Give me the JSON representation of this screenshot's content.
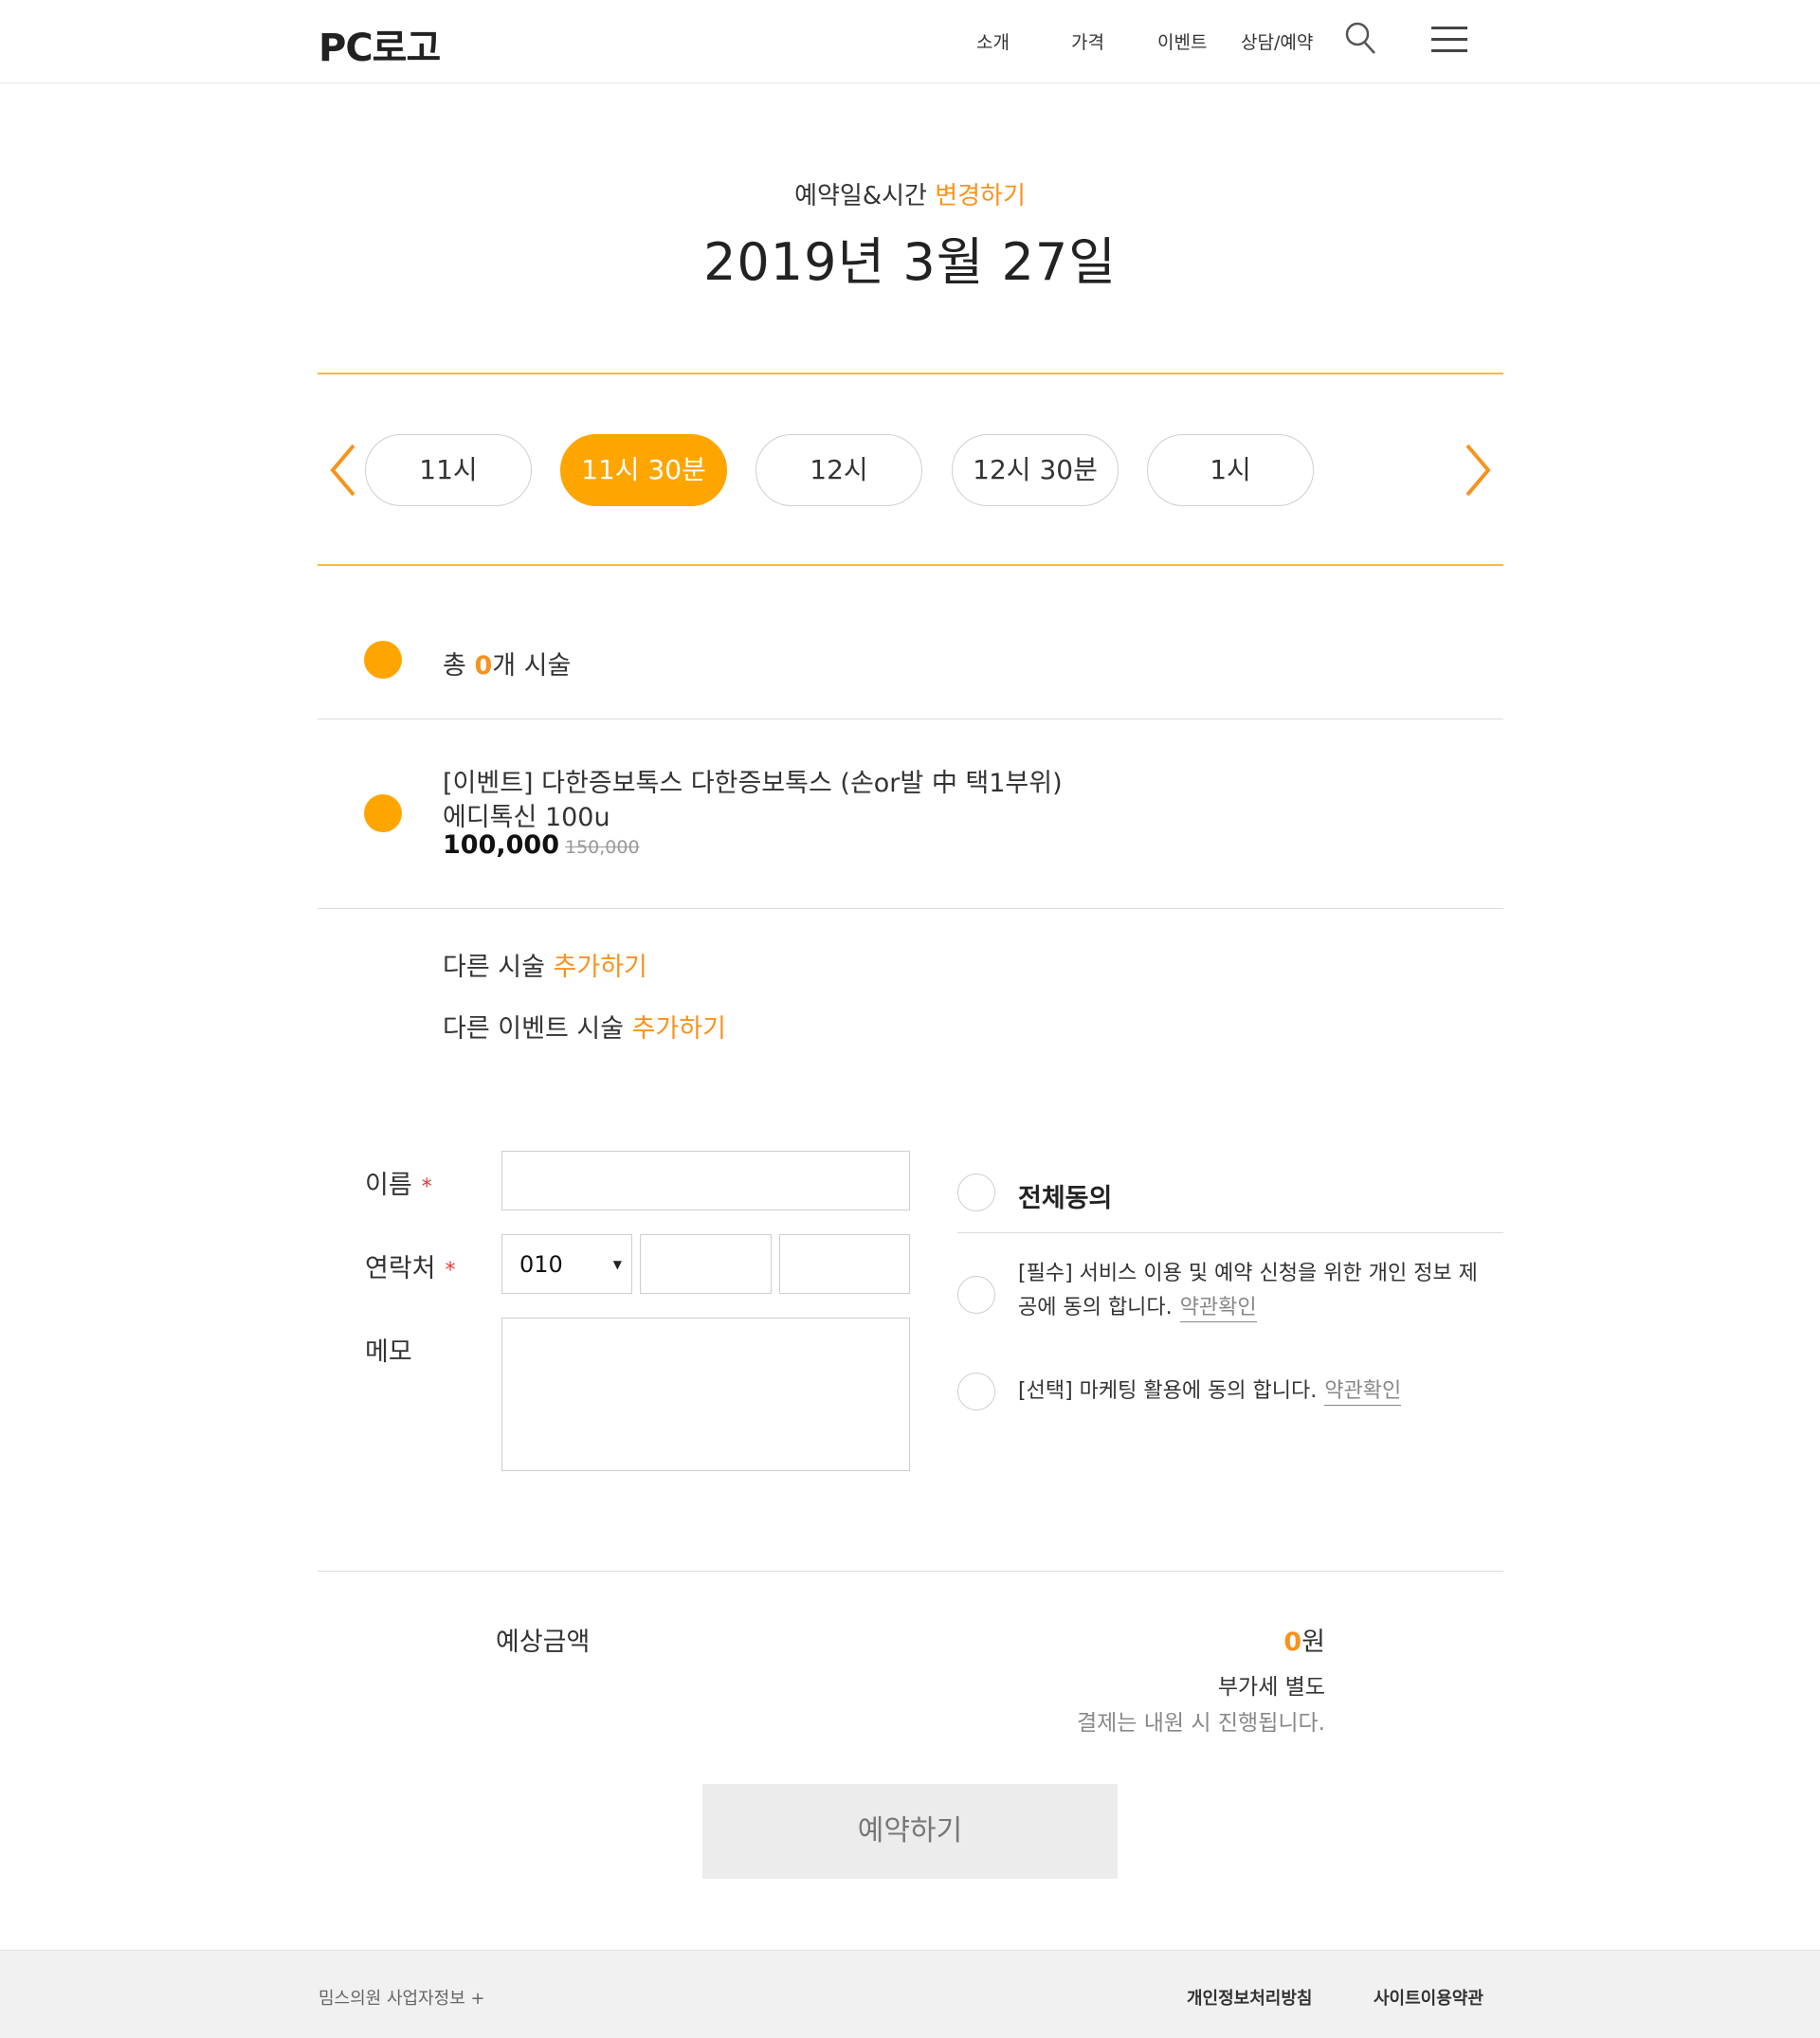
{
  "header": {
    "logo": "PC로고",
    "nav": [
      "소개",
      "가격",
      "이벤트",
      "상담/예약"
    ]
  },
  "schedule": {
    "label": "예약일&시간",
    "change_link": "변경하기",
    "date": "2019년 3월 27일",
    "slots": [
      "11시",
      "11시 30분",
      "12시",
      "12시 30분",
      "1시"
    ],
    "active_slot_index": 1
  },
  "summary": {
    "total_prefix": "총 ",
    "total_count": "0",
    "total_suffix": "개 시술"
  },
  "item": {
    "title": "[이벤트] 다한증보톡스 다한증보톡스 (손or발 中 택1부위)",
    "subtitle": "에디톡신 100u",
    "price": "100,000",
    "old_price": "150,000"
  },
  "add": {
    "other_prefix": "다른 시술 ",
    "other_event_prefix": "다른 이벤트 시술 ",
    "link": "추가하기"
  },
  "form": {
    "name_label": "이름",
    "phone_label": "연락처",
    "memo_label": "메모",
    "required_mark": "*",
    "phone_prefix": "010"
  },
  "agreement": {
    "all": "전체동의",
    "required_line1": "[필수] 서비스 이용 및 예약 신청을 위한 개인 정보 제",
    "required_line2": "공에 동의 합니다.",
    "optional": "[선택] 마케팅 활용에 동의 합니다.",
    "terms_link": "약관확인"
  },
  "amount": {
    "label": "예상금액",
    "value": "0",
    "unit": "원",
    "vat": "부가세 별도",
    "note": "결제는 내원 시 진행됩니다."
  },
  "reserve_button": "예약하기",
  "footer": {
    "business_info": "밈스의원 사업자정보 +",
    "privacy": "개인정보처리방침",
    "terms": "사이트이용약관"
  },
  "colors": {
    "accent": "#ffa500",
    "accent_text": "#f7931e",
    "divider": "#f9bb3c"
  }
}
